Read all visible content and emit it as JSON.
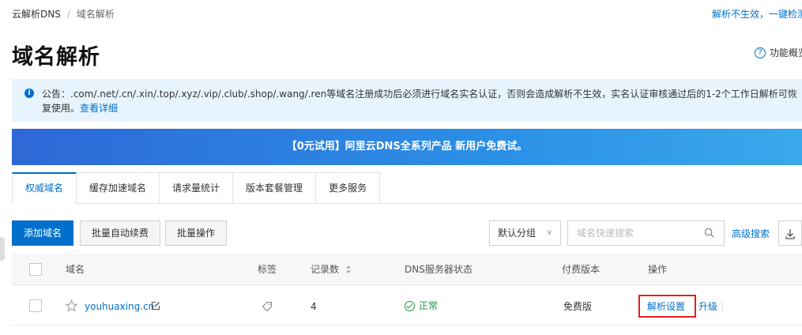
{
  "breadcrumb": {
    "root": "云解析DNS",
    "separator": "/",
    "current": "域名解析"
  },
  "top_link": "解析不生效，一键检测",
  "page_title": "域名解析",
  "help_label": "功能概览",
  "notice": {
    "text": "公告：.com/.net/.cn/.xin/.top/.xyz/.vip/.club/.shop/.wang/.ren等域名注册成功后必须进行域名实名认证，否则会造成解析不生效，实名认证审核通过后的1-2个工作日解析可恢复使用。",
    "link": "查看详细"
  },
  "banner_text": "【0元试用】阿里云DNS全系列产品 新用户免费试。",
  "tabs": [
    {
      "label": "权威域名",
      "active": true
    },
    {
      "label": "缓存加速域名"
    },
    {
      "label": "请求量统计"
    },
    {
      "label": "版本套餐管理"
    },
    {
      "label": "更多服务"
    }
  ],
  "toolbar": {
    "add_domain": "添加域名",
    "auto_renew": "批量自动续费",
    "batch_ops": "批量操作",
    "group_select": "默认分组",
    "search_placeholder": "域名快速搜索",
    "advanced_search": "高级搜索"
  },
  "table": {
    "headers": {
      "domain": "域名",
      "tags": "标签",
      "records": "记录数",
      "dns_status": "DNS服务器状态",
      "plan": "付费版本",
      "actions": "操作"
    },
    "rows": [
      {
        "domain": "youhuaxing.cn",
        "records": "4",
        "dns_status": "正常",
        "plan": "免费版",
        "action_settings": "解析设置",
        "action_upgrade": "升级"
      }
    ]
  },
  "colors": {
    "accent": "#0070cc",
    "status_ok": "#1a9b3a",
    "highlight": "#e02020"
  }
}
